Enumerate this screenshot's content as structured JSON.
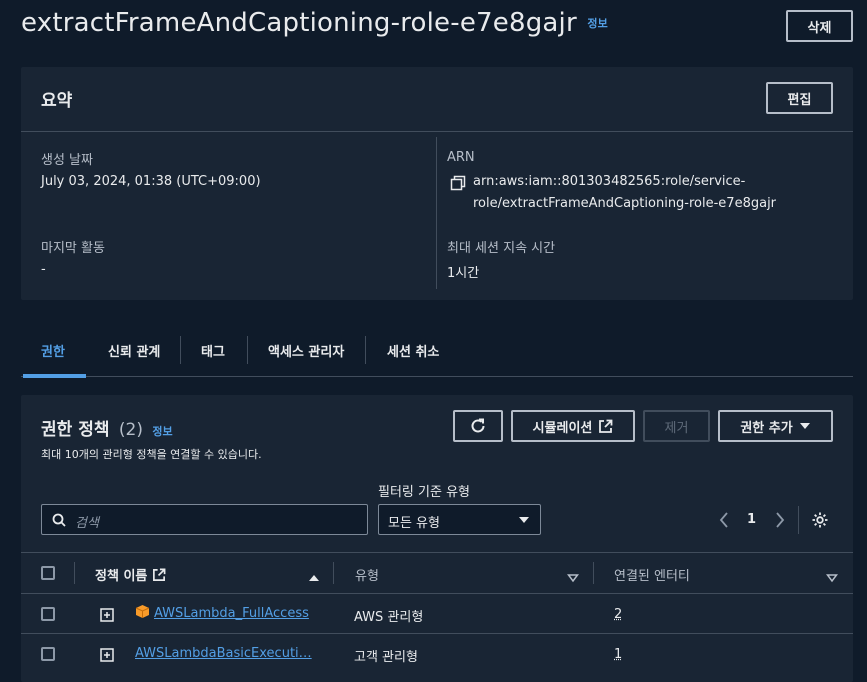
{
  "header": {
    "title": "extractFrameAndCaptioning-role-e7e8gajr",
    "info_label": "정보",
    "delete_label": "삭제"
  },
  "summary": {
    "heading": "요약",
    "edit_label": "편집",
    "created_label": "생성 날짜",
    "created_value": "July 03, 2024, 01:38 (UTC+09:00)",
    "last_activity_label": "마지막 활동",
    "last_activity_value": "-",
    "arn_label": "ARN",
    "arn_line1": "arn:aws:iam::801303482565:role/service-",
    "arn_line2": "role/extractFrameAndCaptioning-role-e7e8gajr",
    "max_session_label": "최대 세션 지속 시간",
    "max_session_value": "1시간"
  },
  "tabs": [
    {
      "label": "권한",
      "active": true
    },
    {
      "label": "신뢰 관계",
      "active": false
    },
    {
      "label": "태그",
      "active": false
    },
    {
      "label": "액세스 관리자",
      "active": false
    },
    {
      "label": "세션 취소",
      "active": false
    }
  ],
  "policies": {
    "heading": "권한 정책",
    "count": "(2)",
    "info_label": "정보",
    "description": "최대 10개의 관리형 정책을 연결할 수 있습니다.",
    "simulation_label": "시뮬레이션",
    "remove_label": "제거",
    "add_label": "권한 추가",
    "search_placeholder": "검색",
    "filter_label": "필터링 기준 유형",
    "filter_value": "모든 유형",
    "page_number": "1",
    "columns": {
      "name": "정책 이름",
      "type": "유형",
      "attached": "연결된 엔터티"
    },
    "rows": [
      {
        "name": "AWSLambda_FullAccess",
        "type": "AWS 관리형",
        "attached": "2"
      },
      {
        "name": "AWSLambdaBasicExecuti…",
        "type": "고객 관리형",
        "attached": "1"
      }
    ]
  },
  "colors": {
    "background": "#0f1b2a",
    "panel": "#192534",
    "link": "#539fe5",
    "aws_managed_icon": "#f89b29"
  },
  "icons": [
    "copy-icon",
    "refresh-icon",
    "external-link-icon",
    "caret-down-icon",
    "search-icon",
    "chevron-left-icon",
    "chevron-right-icon",
    "settings-icon",
    "expand-icon",
    "aws-managed-icon",
    "sort-up-icon",
    "sort-down-icon"
  ]
}
